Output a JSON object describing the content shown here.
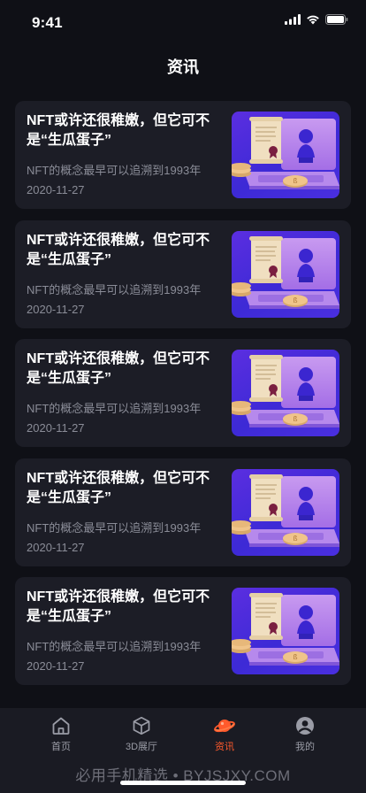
{
  "status_bar": {
    "time": "9:41"
  },
  "header": {
    "title": "资讯"
  },
  "articles": [
    {
      "title": "NFT或许还很稚嫩，但它可不是“生瓜蛋子”",
      "subtitle": "NFT的概念最早可以追溯到1993年",
      "date": "2020-11-27",
      "thumbnail_icon": "nft-laptop-illustration"
    },
    {
      "title": "NFT或许还很稚嫩，但它可不是“生瓜蛋子”",
      "subtitle": "NFT的概念最早可以追溯到1993年",
      "date": "2020-11-27",
      "thumbnail_icon": "nft-laptop-illustration"
    },
    {
      "title": "NFT或许还很稚嫩，但它可不是“生瓜蛋子”",
      "subtitle": "NFT的概念最早可以追溯到1993年",
      "date": "2020-11-27",
      "thumbnail_icon": "nft-laptop-illustration"
    },
    {
      "title": "NFT或许还很稚嫩，但它可不是“生瓜蛋子”",
      "subtitle": "NFT的概念最早可以追溯到1993年",
      "date": "2020-11-27",
      "thumbnail_icon": "nft-laptop-illustration"
    },
    {
      "title": "NFT或许还很稚嫩，但它可不是“生瓜蛋子”",
      "subtitle": "NFT的概念最早可以追溯到1993年",
      "date": "2020-11-27",
      "thumbnail_icon": "nft-laptop-illustration"
    }
  ],
  "tabbar": {
    "items": [
      {
        "label": "首页",
        "icon": "home-icon",
        "active": false
      },
      {
        "label": "3D展厅",
        "icon": "cube-icon",
        "active": false
      },
      {
        "label": "资讯",
        "icon": "planet-icon",
        "active": true
      },
      {
        "label": "我的",
        "icon": "profile-icon",
        "active": false
      }
    ]
  },
  "watermark": "必用手机精选 • BYJSJXY.COM",
  "colors": {
    "background": "#0f1016",
    "card": "#1c1d26",
    "accent": "#ff5a2c",
    "muted_text": "#8a8c97"
  }
}
